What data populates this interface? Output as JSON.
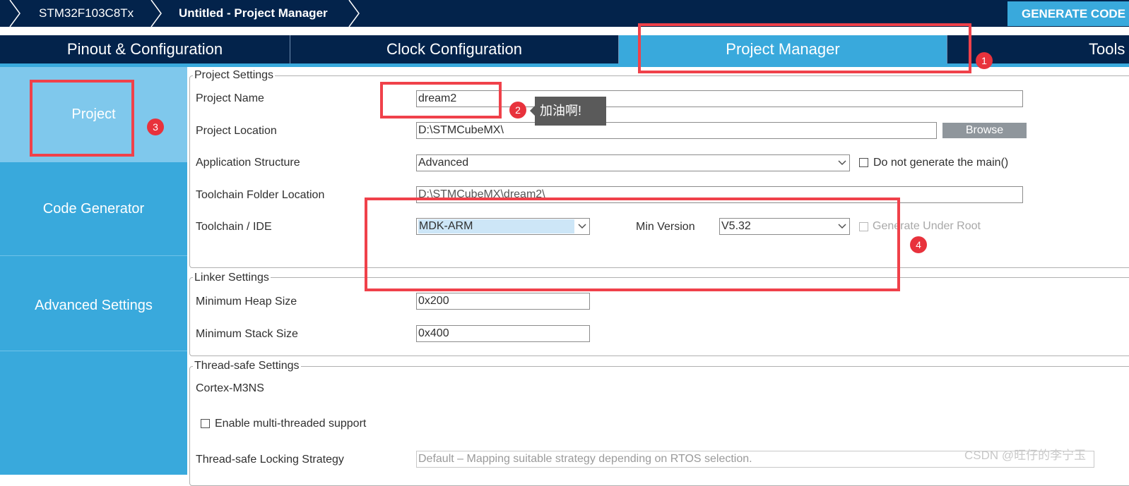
{
  "breadcrumb": {
    "items": [
      "STM32F103C8Tx",
      "Untitled - Project Manager"
    ]
  },
  "generate_button": "GENERATE CODE",
  "tabs": [
    {
      "label": "Pinout & Configuration"
    },
    {
      "label": "Clock Configuration"
    },
    {
      "label": "Project Manager",
      "active": true
    },
    {
      "label": "Tools"
    }
  ],
  "sidebar": {
    "items": [
      {
        "label": "Project",
        "active": true
      },
      {
        "label": "Code Generator"
      },
      {
        "label": "Advanced Settings"
      }
    ]
  },
  "project_settings": {
    "legend": "Project Settings",
    "project_name_label": "Project Name",
    "project_name_value": "dream2",
    "project_location_label": "Project Location",
    "project_location_value": "D:\\STMCubeMX\\",
    "browse_label": "Browse",
    "app_structure_label": "Application Structure",
    "app_structure_value": "Advanced",
    "no_main_label": "Do not generate the main()",
    "toolchain_folder_label": "Toolchain Folder Location",
    "toolchain_folder_value": "D:\\STMCubeMX\\dream2\\",
    "toolchain_ide_label": "Toolchain / IDE",
    "toolchain_ide_value": "MDK-ARM",
    "min_version_label": "Min Version",
    "min_version_value": "V5.32",
    "generate_under_root_label": "Generate Under Root"
  },
  "linker_settings": {
    "legend": "Linker Settings",
    "heap_label": "Minimum Heap Size",
    "heap_value": "0x200",
    "stack_label": "Minimum Stack Size",
    "stack_value": "0x400"
  },
  "thread_safe": {
    "legend": "Thread-safe Settings",
    "core_label": "Cortex-M3NS",
    "multithread_label": "Enable multi-threaded support",
    "locking_label": "Thread-safe Locking Strategy",
    "locking_value": "Default  –  Mapping suitable strategy depending on RTOS selection."
  },
  "annotations": {
    "badges": [
      "1",
      "2",
      "3",
      "4"
    ],
    "tooltip": "加油啊!",
    "color": "#f0414a"
  },
  "watermark": "CSDN @旺仔的李宁玉",
  "colors": {
    "navy": "#03234b",
    "accent": "#39a9dc",
    "sidebar_active": "#7fc8ec"
  }
}
